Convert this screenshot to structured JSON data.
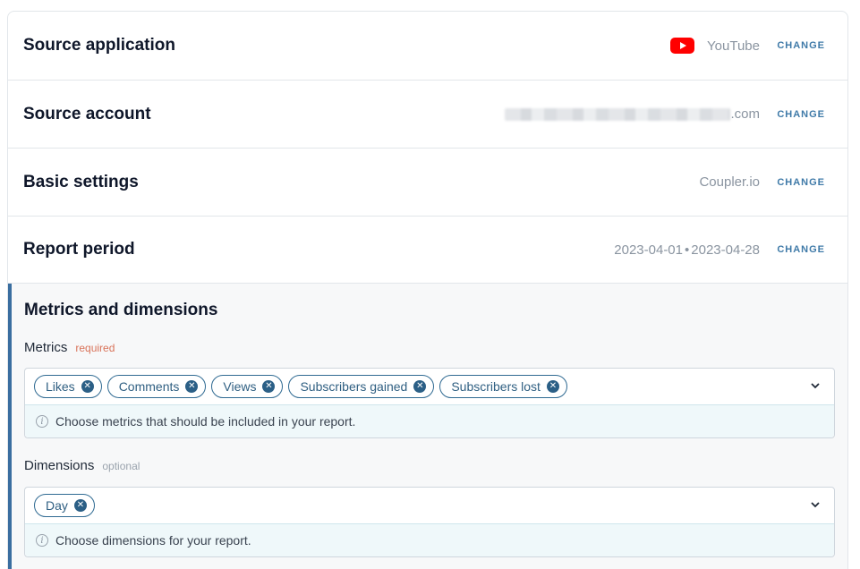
{
  "rows": [
    {
      "title": "Source application",
      "value": "YouTube",
      "icon": "youtube-icon",
      "change": "CHANGE"
    },
    {
      "title": "Source account",
      "value": ".com",
      "redacted": true,
      "change": "CHANGE"
    },
    {
      "title": "Basic settings",
      "value": "Coupler.io",
      "change": "CHANGE"
    },
    {
      "title": "Report period",
      "value_start": "2023-04-01",
      "value_end": "2023-04-28",
      "separator": "•",
      "change": "CHANGE"
    }
  ],
  "metrics_section": {
    "title": "Metrics and dimensions",
    "metrics": {
      "label": "Metrics",
      "tag": "required",
      "chips": [
        "Likes",
        "Comments",
        "Views",
        "Subscribers gained",
        "Subscribers lost"
      ],
      "hint": "Choose metrics that should be included in your report."
    },
    "dimensions": {
      "label": "Dimensions",
      "tag": "optional",
      "chips": [
        "Day"
      ],
      "hint": "Choose dimensions for your report."
    }
  },
  "colors": {
    "accent": "#3f7aa8",
    "chip_border": "#2f6a92",
    "required": "#d9735a",
    "youtube_red": "#ff0000"
  }
}
